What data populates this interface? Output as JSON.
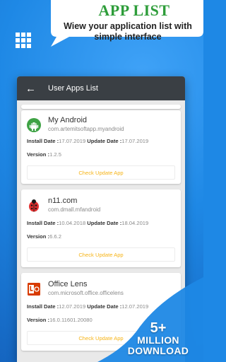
{
  "promo": {
    "title": "APP LIST",
    "subtitle": "Wiew your application list with simple interface",
    "title_color": "#2e9d3a"
  },
  "app_bar": {
    "title": "User Apps List",
    "back_icon": "arrow-left-icon",
    "background": "#3a3f44"
  },
  "labels": {
    "install_date": "Install Date :",
    "update_date": "Update Date :",
    "version": "Version :",
    "check_update": "Check Update App"
  },
  "apps": [
    {
      "name": "My Android",
      "package": "com.artemitsoftapp.myandroid",
      "install_date": "17.07.2019",
      "update_date": "17.07.2019",
      "version": "1.2.5",
      "icon": "android-robot-icon"
    },
    {
      "name": "n11.com",
      "package": "com.dmall.mfandroid",
      "install_date": "10.04.2018",
      "update_date": "18.04.2019",
      "version": "6.6.2",
      "icon": "ladybug-icon"
    },
    {
      "name": "Office Lens",
      "package": "com.microsoft.office.officelens",
      "install_date": "12.07.2019",
      "update_date": "12.07.2019",
      "version": "16.0.11601.20080",
      "icon": "office-lens-icon"
    }
  ],
  "badge": {
    "number": "5+",
    "line1": "MILLION",
    "line2": "DOWNLOAD"
  },
  "colors": {
    "background": "#1e88e5",
    "button_text": "#f6b418"
  }
}
